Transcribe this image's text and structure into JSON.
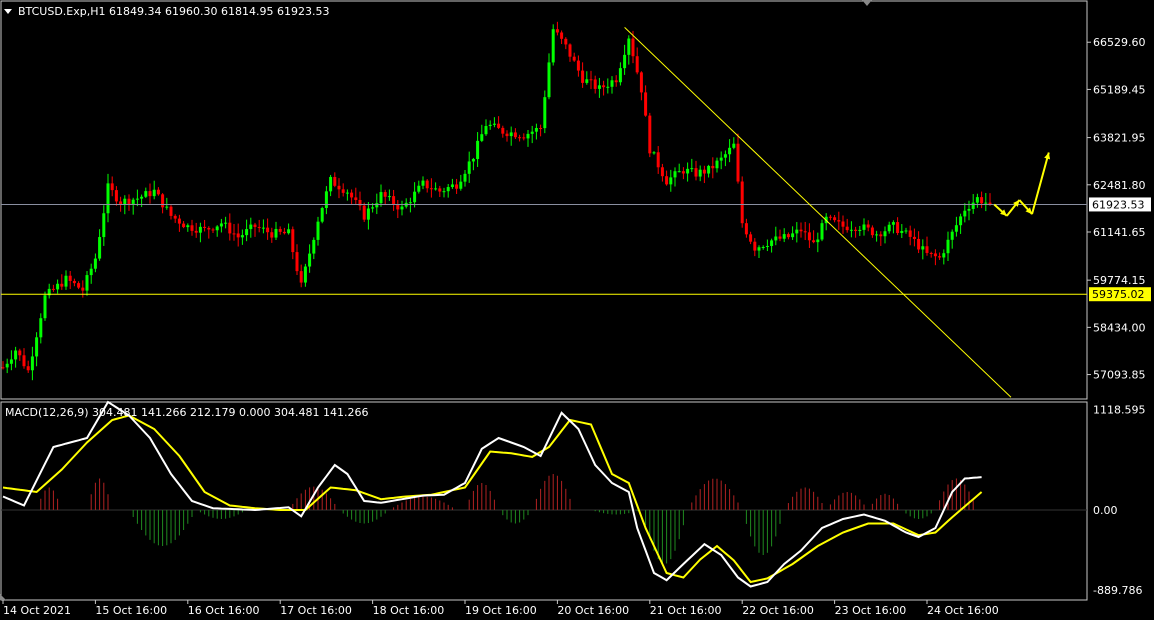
{
  "header": {
    "symbol_line": "BTCUSD.Exp,H1  61849.34 61960.30 61814.95 61923.53",
    "macd_line": "MACD(12,26,9) 304.481 141.266 212.179 0.000 304.481 141.266"
  },
  "colors": {
    "background": "#000000",
    "frame": "#c8c8c8",
    "bull_candle": "#00ff00",
    "bear_candle": "#ff0000",
    "support_line": "#ffff00",
    "trend_line": "#ffff00",
    "price_line": "#8a8fa0",
    "forecast_arrow": "#ffff00",
    "macd_line": "#ffffff",
    "signal_line": "#ffff00",
    "hist_pos": "#b22222",
    "hist_neg": "#1f8a1f"
  },
  "chart_data": [
    {
      "type": "candlestick",
      "symbol": "BTCUSD.Exp",
      "timeframe": "H1",
      "ohlc_current": {
        "open": 61849.34,
        "high": 61960.3,
        "low": 61814.95,
        "close": 61923.53
      },
      "ylim": [
        56400,
        67700
      ],
      "y_tick_labels": [
        "66529.60",
        "65189.45",
        "63821.95",
        "62481.80",
        "61141.65",
        "59774.15",
        "58434.00",
        "57093.85"
      ],
      "y_ticks": [
        66529.6,
        65189.45,
        63821.95,
        62481.8,
        61141.65,
        59774.15,
        58434.0,
        57093.85
      ],
      "current_price_label": "61923.53",
      "current_price": 61923.53,
      "support_label": "59375.02",
      "support_level": 59375.02,
      "trend_line": {
        "from": {
          "index": 148,
          "price": 66950
        },
        "to": {
          "index": 240,
          "price": 56450
        }
      },
      "price_path": [
        [
          0,
          57300
        ],
        [
          3,
          57800
        ],
        [
          6,
          57200
        ],
        [
          10,
          59300
        ],
        [
          15,
          59800
        ],
        [
          19,
          59500
        ],
        [
          22,
          60400
        ],
        [
          25,
          62400
        ],
        [
          28,
          62000
        ],
        [
          32,
          62100
        ],
        [
          36,
          62300
        ],
        [
          40,
          61600
        ],
        [
          44,
          61300
        ],
        [
          48,
          61200
        ],
        [
          52,
          61400
        ],
        [
          56,
          61000
        ],
        [
          60,
          61300
        ],
        [
          64,
          61100
        ],
        [
          68,
          61100
        ],
        [
          71,
          59600
        ],
        [
          75,
          61500
        ],
        [
          78,
          62600
        ],
        [
          82,
          62300
        ],
        [
          86,
          61600
        ],
        [
          90,
          62200
        ],
        [
          95,
          61800
        ],
        [
          100,
          62500
        ],
        [
          104,
          62300
        ],
        [
          108,
          62500
        ],
        [
          112,
          63300
        ],
        [
          115,
          64200
        ],
        [
          119,
          64000
        ],
        [
          124,
          63900
        ],
        [
          128,
          64100
        ],
        [
          131,
          66900
        ],
        [
          134,
          66400
        ],
        [
          138,
          65500
        ],
        [
          142,
          65200
        ],
        [
          146,
          65500
        ],
        [
          149,
          66700
        ],
        [
          152,
          65200
        ],
        [
          154,
          63500
        ],
        [
          158,
          62600
        ],
        [
          162,
          62900
        ],
        [
          165,
          62800
        ],
        [
          168,
          62900
        ],
        [
          171,
          63200
        ],
        [
          174,
          63600
        ],
        [
          176,
          61400
        ],
        [
          179,
          60700
        ],
        [
          183,
          60900
        ],
        [
          187,
          61000
        ],
        [
          190,
          61200
        ],
        [
          193,
          60800
        ],
        [
          196,
          61500
        ],
        [
          200,
          61300
        ],
        [
          204,
          61300
        ],
        [
          208,
          61100
        ],
        [
          212,
          61300
        ],
        [
          216,
          61000
        ],
        [
          220,
          60500
        ],
        [
          223,
          60400
        ],
        [
          226,
          61100
        ],
        [
          229,
          61800
        ],
        [
          232,
          62100
        ],
        [
          235,
          61923
        ]
      ],
      "x_tick_labels": [
        "14 Oct 2021",
        "15 Oct 16:00",
        "16 Oct 16:00",
        "17 Oct 16:00",
        "18 Oct 16:00",
        "19 Oct 16:00",
        "20 Oct 16:00",
        "21 Oct 16:00",
        "22 Oct 16:00",
        "23 Oct 16:00",
        "24 Oct 16:00"
      ],
      "x_tick_index": [
        0,
        22,
        44,
        66,
        88,
        110,
        132,
        154,
        176,
        198,
        220
      ],
      "bar_count": 236,
      "forecast": [
        [
          236,
          61923
        ],
        [
          239,
          61600
        ],
        [
          242,
          62050
        ],
        [
          245,
          61650
        ],
        [
          249,
          63400
        ]
      ]
    },
    {
      "type": "macd",
      "params": "12,26,9",
      "ylim": [
        -1000,
        1200
      ],
      "y_tick_labels": [
        "1118.595",
        "0.00",
        "-889.786"
      ],
      "y_ticks": [
        1118.595,
        0,
        -889.786
      ],
      "macd_path": [
        [
          0,
          150
        ],
        [
          5,
          50
        ],
        [
          12,
          700
        ],
        [
          20,
          800
        ],
        [
          25,
          1200
        ],
        [
          30,
          1050
        ],
        [
          35,
          800
        ],
        [
          40,
          400
        ],
        [
          45,
          100
        ],
        [
          50,
          20
        ],
        [
          60,
          0
        ],
        [
          68,
          30
        ],
        [
          71,
          -70
        ],
        [
          75,
          250
        ],
        [
          79,
          500
        ],
        [
          82,
          400
        ],
        [
          86,
          100
        ],
        [
          90,
          80
        ],
        [
          95,
          120
        ],
        [
          100,
          160
        ],
        [
          105,
          170
        ],
        [
          110,
          300
        ],
        [
          114,
          680
        ],
        [
          118,
          800
        ],
        [
          124,
          700
        ],
        [
          128,
          600
        ],
        [
          133,
          1080
        ],
        [
          137,
          900
        ],
        [
          141,
          500
        ],
        [
          145,
          300
        ],
        [
          149,
          200
        ],
        [
          151,
          -200
        ],
        [
          155,
          -700
        ],
        [
          158,
          -780
        ],
        [
          162,
          -600
        ],
        [
          167,
          -380
        ],
        [
          171,
          -500
        ],
        [
          175,
          -750
        ],
        [
          178,
          -850
        ],
        [
          182,
          -800
        ],
        [
          186,
          -600
        ],
        [
          190,
          -450
        ],
        [
          195,
          -200
        ],
        [
          200,
          -100
        ],
        [
          205,
          -50
        ],
        [
          210,
          -120
        ],
        [
          215,
          -250
        ],
        [
          218,
          -300
        ],
        [
          222,
          -200
        ],
        [
          226,
          200
        ],
        [
          229,
          350
        ],
        [
          233,
          365
        ]
      ],
      "signal_path": [
        [
          0,
          250
        ],
        [
          8,
          200
        ],
        [
          14,
          450
        ],
        [
          20,
          750
        ],
        [
          26,
          1000
        ],
        [
          30,
          1050
        ],
        [
          36,
          900
        ],
        [
          42,
          600
        ],
        [
          48,
          200
        ],
        [
          54,
          50
        ],
        [
          60,
          20
        ],
        [
          66,
          0
        ],
        [
          72,
          0
        ],
        [
          78,
          250
        ],
        [
          84,
          220
        ],
        [
          90,
          120
        ],
        [
          96,
          150
        ],
        [
          102,
          170
        ],
        [
          110,
          250
        ],
        [
          116,
          650
        ],
        [
          121,
          630
        ],
        [
          126,
          590
        ],
        [
          130,
          700
        ],
        [
          135,
          1000
        ],
        [
          140,
          950
        ],
        [
          145,
          400
        ],
        [
          149,
          300
        ],
        [
          153,
          -200
        ],
        [
          158,
          -700
        ],
        [
          162,
          -750
        ],
        [
          166,
          -550
        ],
        [
          170,
          -400
        ],
        [
          174,
          -560
        ],
        [
          178,
          -800
        ],
        [
          182,
          -760
        ],
        [
          188,
          -600
        ],
        [
          194,
          -400
        ],
        [
          200,
          -250
        ],
        [
          206,
          -150
        ],
        [
          212,
          -150
        ],
        [
          218,
          -280
        ],
        [
          222,
          -250
        ],
        [
          226,
          -80
        ],
        [
          233,
          200
        ]
      ],
      "histogram_bumps": [
        [
          8,
          14,
          250
        ],
        [
          20,
          26,
          350
        ],
        [
          30,
          46,
          -400
        ],
        [
          46,
          58,
          -100
        ],
        [
          68,
          80,
          260
        ],
        [
          80,
          92,
          -150
        ],
        [
          92,
          108,
          150
        ],
        [
          110,
          118,
          300
        ],
        [
          118,
          126,
          -150
        ],
        [
          126,
          136,
          400
        ],
        [
          140,
          152,
          -50
        ],
        [
          152,
          163,
          -600
        ],
        [
          163,
          176,
          350
        ],
        [
          176,
          186,
          -500
        ],
        [
          186,
          196,
          250
        ],
        [
          196,
          206,
          200
        ],
        [
          206,
          214,
          180
        ],
        [
          214,
          222,
          -100
        ],
        [
          222,
          232,
          350
        ]
      ]
    }
  ]
}
